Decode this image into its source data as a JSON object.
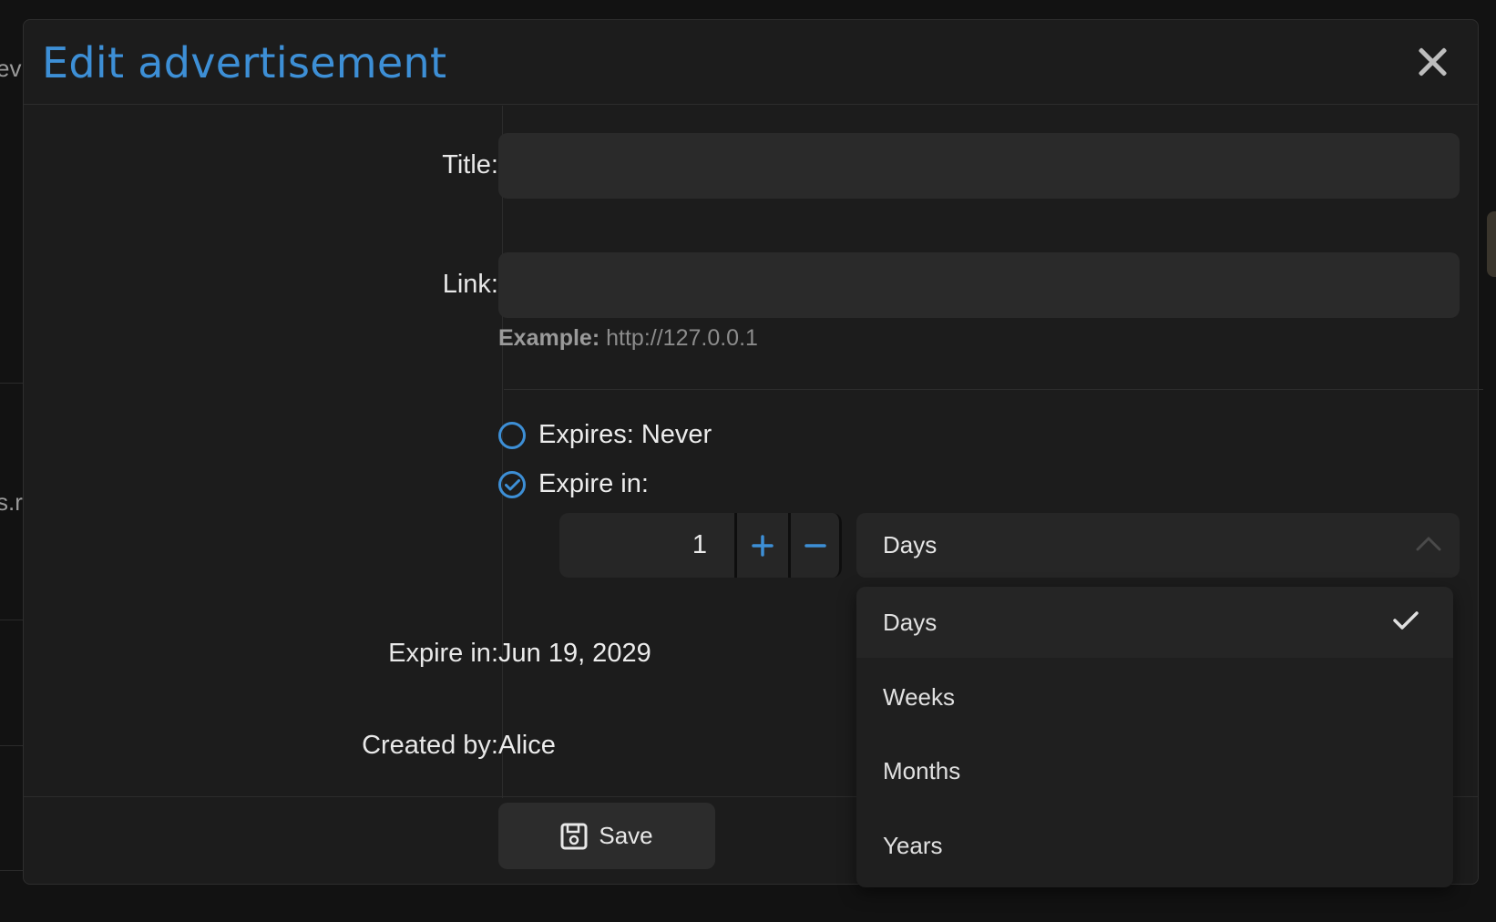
{
  "background": {
    "fragment_top": "ev",
    "fragment_mid": "s.r"
  },
  "modal": {
    "title": "Edit advertisement",
    "close_icon": "close-icon"
  },
  "form": {
    "title_label": "Title:",
    "title_value": "",
    "link_label": "Link:",
    "link_value": "",
    "link_hint_label": "Example:",
    "link_hint_value": "http://127.0.0.1",
    "expires_never_label": "Expires: Never",
    "expire_in_label": "Expire in:",
    "expire_mode": "expire-in",
    "stepper_value": "1",
    "unit_selected": "Days",
    "unit_options": [
      "Days",
      "Weeks",
      "Months",
      "Years"
    ],
    "expire_date_label": "Expire in:",
    "expire_date_value": "Jun 19, 2029",
    "created_by_label": "Created by:",
    "created_by_value": "Alice"
  },
  "footer": {
    "save_label": "Save",
    "save_icon": "floppy-disk-icon"
  },
  "colors": {
    "accent": "#3d8fd6",
    "background": "#1c1c1c",
    "input": "#2a2a2a"
  }
}
